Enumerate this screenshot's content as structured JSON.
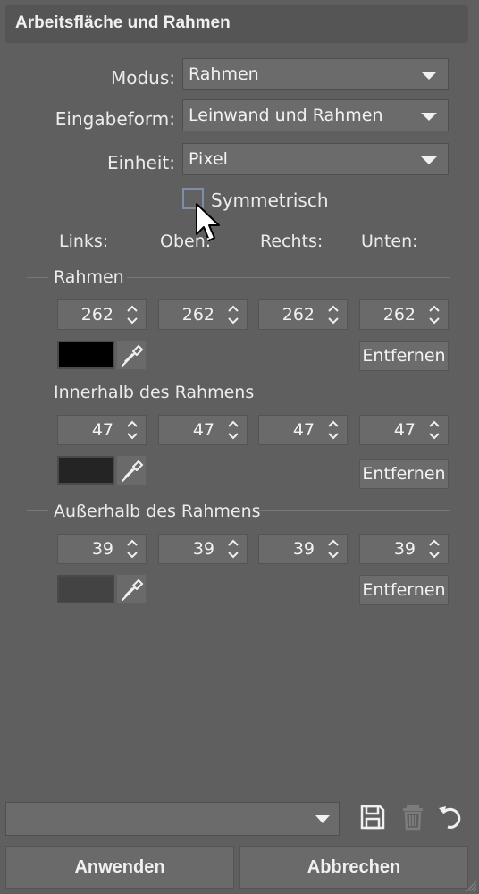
{
  "window": {
    "title": "Arbeitsfläche und Rahmen"
  },
  "form": {
    "modus": {
      "label": "Modus:",
      "value": "Rahmen"
    },
    "eingabeform": {
      "label": "Eingabeform:",
      "value": "Leinwand und Rahmen"
    },
    "einheit": {
      "label": "Einheit:",
      "value": "Pixel"
    },
    "symmetrisch": {
      "label": "Symmetrisch",
      "checked": false
    }
  },
  "columns": [
    "Links:",
    "Oben:",
    "Rechts:",
    "Unten:"
  ],
  "sections": [
    {
      "label": "Rahmen",
      "values": [
        "262",
        "262",
        "262",
        "262"
      ],
      "color": "#000000",
      "remove_label": "Entfernen"
    },
    {
      "label": "Innerhalb des Rahmens",
      "values": [
        "47",
        "47",
        "47",
        "47"
      ],
      "color": "#242424",
      "remove_label": "Entfernen"
    },
    {
      "label": "Außerhalb des Rahmens",
      "values": [
        "39",
        "39",
        "39",
        "39"
      ],
      "color": "#434343",
      "remove_label": "Entfernen"
    }
  ],
  "footer": {
    "preset_value": "",
    "icons": [
      "save-icon",
      "trash-icon",
      "undo-icon"
    ],
    "apply_label": "Anwenden",
    "cancel_label": "Abbrechen"
  }
}
